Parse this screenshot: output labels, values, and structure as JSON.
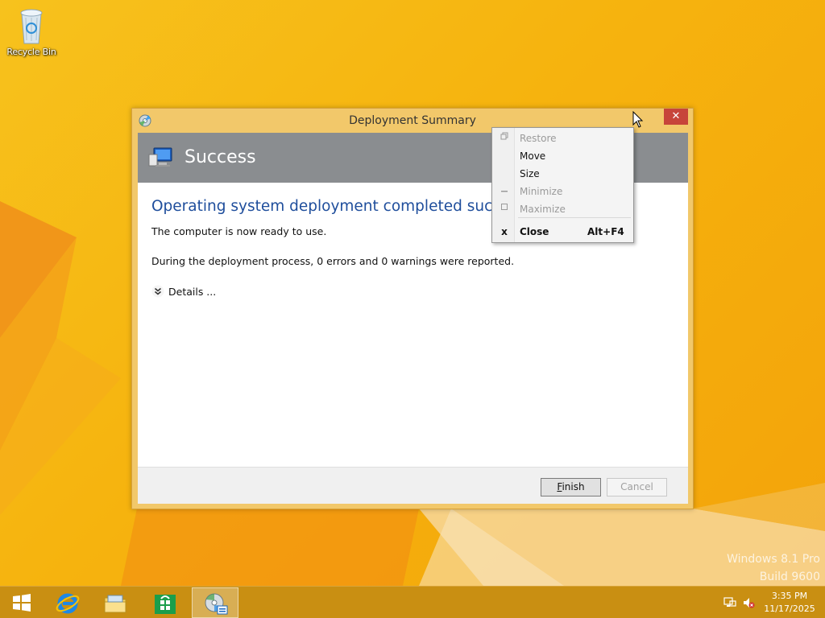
{
  "desktop": {
    "icons": [
      {
        "label": "Recycle Bin",
        "icon": "recycle-bin-icon"
      }
    ],
    "watermark": {
      "line1": "Windows 8.1 Pro",
      "line2": "Build 9600"
    }
  },
  "dialog": {
    "title": "Deployment Summary",
    "close_glyph": "✕",
    "banner_title": "Success",
    "heading": "Operating system deployment completed successfully",
    "message": "The computer is now ready to use.",
    "report": "During the deployment process, 0 errors and 0 warnings were reported.",
    "details_label": "Details ...",
    "buttons": {
      "finish_mnemonic": "F",
      "finish_rest": "inish",
      "cancel": "Cancel"
    }
  },
  "system_menu": {
    "items": [
      {
        "label": "Restore",
        "enabled": false,
        "icon": "restore-icon"
      },
      {
        "label": "Move",
        "enabled": true
      },
      {
        "label": "Size",
        "enabled": true
      },
      {
        "label": "Minimize",
        "enabled": false,
        "icon": "minimize-icon"
      },
      {
        "label": "Maximize",
        "enabled": false,
        "icon": "maximize-icon"
      },
      {
        "label": "Close",
        "enabled": true,
        "icon": "close-icon",
        "icon_glyph": "x",
        "accelerator": "Alt+F4"
      }
    ]
  },
  "taskbar": {
    "buttons": [
      {
        "name": "start",
        "icon": "windows-logo-icon"
      },
      {
        "name": "internet-explorer",
        "icon": "internet-explorer-icon"
      },
      {
        "name": "file-explorer",
        "icon": "folder-icon"
      },
      {
        "name": "store",
        "icon": "store-icon"
      },
      {
        "name": "deployment-wizard",
        "icon": "deployment-disc-icon",
        "active": true
      }
    ],
    "tray": {
      "network_icon": "network-disconnected-icon",
      "volume_icon": "volume-muted-icon",
      "time": "3:35 PM",
      "date": "11/17/2025"
    }
  },
  "colors": {
    "wallpaper": "#f6b20c",
    "heading": "#1f4e9c",
    "banner": "#8a8d90",
    "close_button": "#c7453a"
  }
}
